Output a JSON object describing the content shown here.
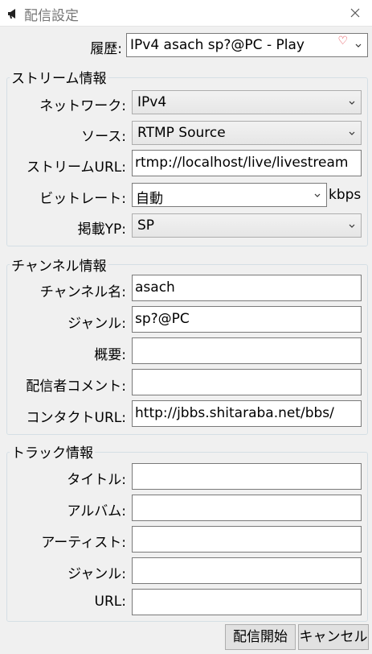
{
  "window": {
    "title": "配信設定",
    "app_icon": "megaphone-icon",
    "close_icon": "close-icon"
  },
  "history": {
    "label": "履歴:",
    "value": "IPv4 asach sp?@PC  -  Play",
    "heart": "♡"
  },
  "stream": {
    "group_title": "ストリーム情報",
    "network_label": "ネットワーク:",
    "network_value": "IPv4",
    "source_label": "ソース:",
    "source_value": "RTMP Source",
    "url_label": "ストリームURL:",
    "url_value": "rtmp://localhost/live/livestream",
    "bitrate_label": "ビットレート:",
    "bitrate_value": "自動",
    "bitrate_unit": "kbps",
    "yp_label": "掲載YP:",
    "yp_value": "SP"
  },
  "channel": {
    "group_title": "チャンネル情報",
    "name_label": "チャンネル名:",
    "name_value": "asach",
    "genre_label": "ジャンル:",
    "genre_value": "sp?@PC",
    "desc_label": "概要:",
    "desc_value": "",
    "comment_label": "配信者コメント:",
    "comment_value": "",
    "contact_label": "コンタクトURL:",
    "contact_value": "http://jbbs.shitaraba.net/bbs/"
  },
  "track": {
    "group_title": "トラック情報",
    "title_label": "タイトル:",
    "title_value": "",
    "album_label": "アルバム:",
    "album_value": "",
    "artist_label": "アーティスト:",
    "artist_value": "",
    "genre_label": "ジャンル:",
    "genre_value": "",
    "url_label": "URL:",
    "url_value": ""
  },
  "buttons": {
    "start_label": "配信開始",
    "cancel_label": "キャンセル"
  }
}
